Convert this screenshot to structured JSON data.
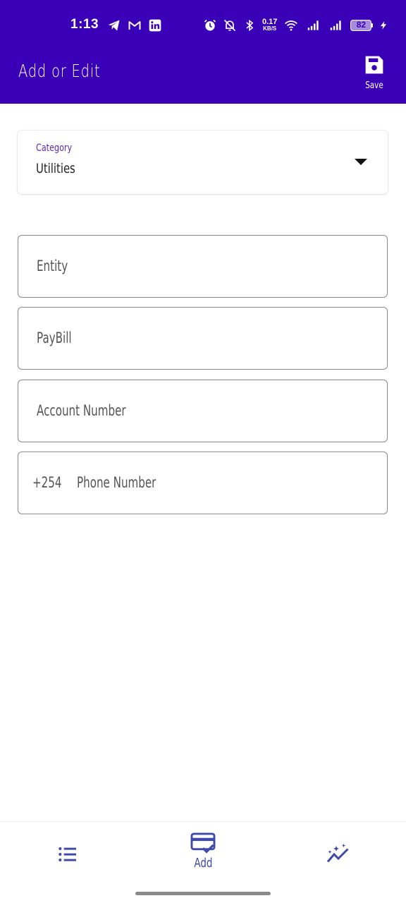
{
  "status_bar": {
    "time": "1:13",
    "net_speed_value": "0.17",
    "net_speed_unit": "KB/S",
    "battery_level": "82",
    "icons_left": [
      "telegram-icon",
      "gmail-icon",
      "linkedin-icon"
    ],
    "icons_right": [
      "alarm-icon",
      "mute-icon",
      "bluetooth-icon",
      "wifi-icon",
      "signal-icon",
      "signal-icon",
      "charging-icon"
    ]
  },
  "app_bar": {
    "title": "Add or Edit",
    "save_label": "Save",
    "save_icon": "floppy-disk-icon"
  },
  "form": {
    "category": {
      "label": "Category",
      "value": "Utilities"
    },
    "entity_placeholder": "Entity",
    "paybill_placeholder": "PayBill",
    "account_placeholder": "Account Number",
    "phone_prefix": "+254",
    "phone_placeholder": "Phone Number"
  },
  "bottom_nav": {
    "items": [
      {
        "icon": "list-icon",
        "label": ""
      },
      {
        "icon": "add-card-icon",
        "label": "Add"
      },
      {
        "icon": "insights-icon",
        "label": ""
      }
    ]
  },
  "colors": {
    "primary": "#3a00b8",
    "accent_label": "#5e2bb0",
    "nav_icon": "#3f4aa8"
  }
}
